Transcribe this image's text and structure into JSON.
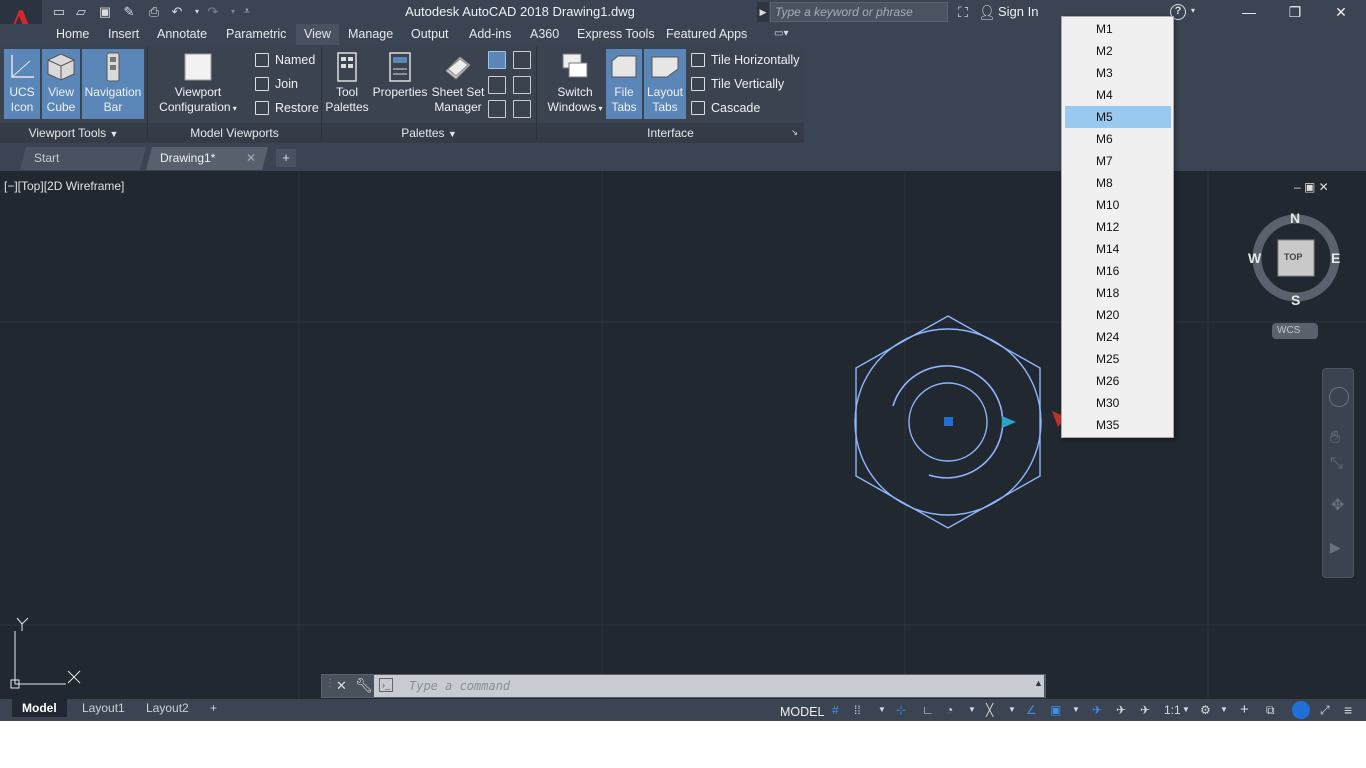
{
  "window": {
    "title": "Autodesk AutoCAD 2018    Drawing1.dwg",
    "controls": {
      "minimize": "—",
      "restore": "❐",
      "close": "✕"
    }
  },
  "search": {
    "placeholder": "Type a keyword or phrase"
  },
  "account": {
    "sign_in": "Sign In"
  },
  "ribbon_tabs": [
    "Home",
    "Insert",
    "Annotate",
    "Parametric",
    "View",
    "Manage",
    "Output",
    "Add-ins",
    "A360",
    "Express Tools",
    "Featured Apps"
  ],
  "active_ribbon_tab": "View",
  "ribbon": {
    "viewport_tools": {
      "footer": "Viewport Tools",
      "ucs_icon": [
        "UCS",
        "Icon"
      ],
      "view_cube": [
        "View",
        "Cube"
      ],
      "navigation_bar": [
        "Navigation",
        "Bar"
      ]
    },
    "model_viewports": {
      "footer": "Model Viewports",
      "viewport_configuration": [
        "Viewport",
        "Configuration"
      ],
      "named": "Named",
      "join": "Join",
      "restore": "Restore"
    },
    "palettes": {
      "footer": "Palettes",
      "tool_palettes": [
        "Tool",
        "Palettes"
      ],
      "properties": "Properties",
      "sheet_set_manager": [
        "Sheet Set",
        "Manager"
      ]
    },
    "interface": {
      "footer": "Interface",
      "switch_windows": [
        "Switch",
        "Windows"
      ],
      "file_tabs": [
        "File",
        "Tabs"
      ],
      "layout_tabs": [
        "Layout",
        "Tabs"
      ],
      "tile_horizontally": "Tile Horizontally",
      "tile_vertically": "Tile Vertically",
      "cascade": "Cascade"
    }
  },
  "file_tabs": [
    {
      "label": "Start",
      "active": false
    },
    {
      "label": "Drawing1*",
      "active": true
    }
  ],
  "viewport": {
    "label": "[−][Top][2D Wireframe]",
    "controls": "–  ▣  ✕"
  },
  "viewcube": {
    "face": "TOP",
    "north": "N",
    "south": "S",
    "east": "E",
    "west": "W",
    "coord_system": "WCS"
  },
  "ucs_axes": {
    "x": "X",
    "y": "Y"
  },
  "command_line": {
    "placeholder": "Type a command"
  },
  "layout_tabs": [
    {
      "label": "Model",
      "active": true
    },
    {
      "label": "Layout1",
      "active": false
    },
    {
      "label": "Layout2",
      "active": false
    }
  ],
  "status_bar": {
    "model": "MODEL",
    "scale": "1:1"
  },
  "dropdown": {
    "items": [
      "M1",
      "M2",
      "M3",
      "M4",
      "M5",
      "M6",
      "M7",
      "M8",
      "M10",
      "M12",
      "M14",
      "M16",
      "M18",
      "M20",
      "M24",
      "M25",
      "M26",
      "M30",
      "M35"
    ],
    "selected": "M5"
  },
  "colors": {
    "drawing_background": "#212830",
    "chrome": "#3b4453",
    "highlight": "#99c9ef",
    "geometry": "#8fb6ff",
    "accent_blue": "#1f6fd6"
  }
}
